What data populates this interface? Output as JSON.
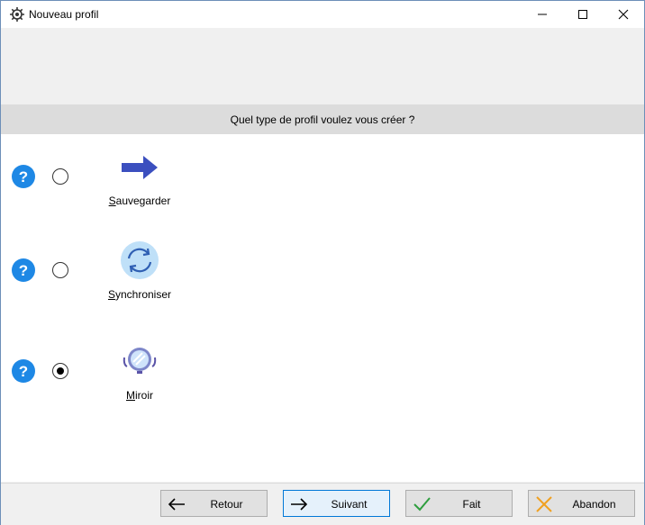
{
  "window": {
    "title": "Nouveau profil",
    "app_icon": "gear-app-icon",
    "controls": [
      "minimize-icon",
      "maximize-icon",
      "close-icon"
    ]
  },
  "header": {
    "question": "Quel type de profil voulez vous créer ?"
  },
  "options": [
    {
      "label": "Sauvegarder",
      "icon": "arrow-right-icon",
      "selected": false,
      "help_icon": "question-icon"
    },
    {
      "label": "Synchroniser",
      "icon": "sync-icon",
      "selected": false,
      "help_icon": "question-icon"
    },
    {
      "label": "Miroir",
      "icon": "mirror-icon",
      "selected": true,
      "help_icon": "question-icon"
    }
  ],
  "footer": {
    "back_label": "Retour",
    "next_label": "Suivant",
    "done_label": "Fait",
    "cancel_label": "Abandon"
  },
  "colors": {
    "help_blue": "#1e88e5",
    "arrow_blue": "#3b4fbf",
    "sync_bg": "#bfe0f8",
    "check_green": "#2e9e3e",
    "cancel_orange": "#f0a020",
    "accent": "#0078d7"
  }
}
